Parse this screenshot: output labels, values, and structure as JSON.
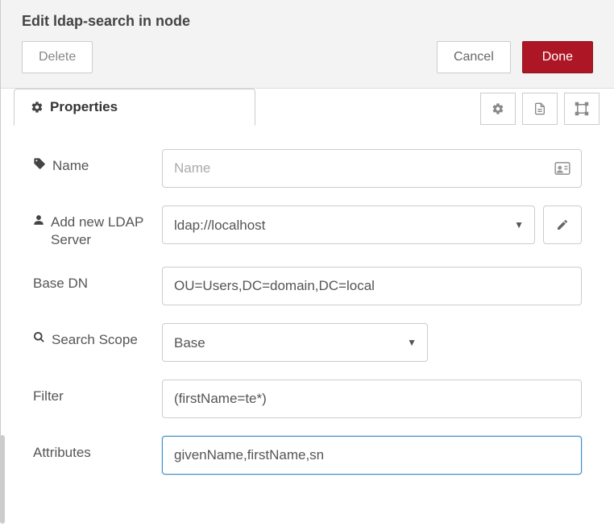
{
  "header": {
    "title": "Edit ldap-search in node",
    "delete_label": "Delete",
    "cancel_label": "Cancel",
    "done_label": "Done"
  },
  "tabs": {
    "active": "Properties"
  },
  "form": {
    "name": {
      "label": "Name",
      "placeholder": "Name",
      "value": ""
    },
    "ldap_server": {
      "label": "Add new LDAP Server",
      "selected": "ldap://localhost"
    },
    "base_dn": {
      "label": "Base DN",
      "value": "OU=Users,DC=domain,DC=local"
    },
    "search_scope": {
      "label": "Search Scope",
      "selected": "Base"
    },
    "filter": {
      "label": "Filter",
      "value": "(firstName=te*)"
    },
    "attributes": {
      "label": "Attributes",
      "value": "givenName,firstName,sn"
    }
  }
}
